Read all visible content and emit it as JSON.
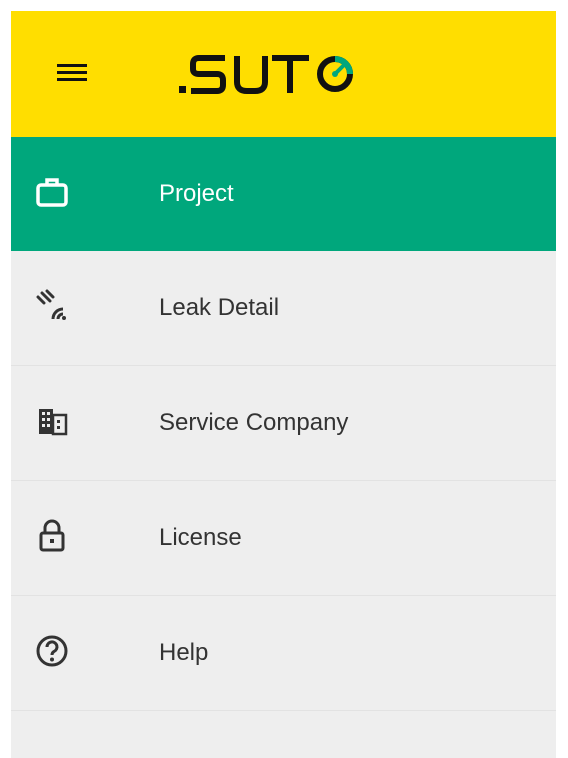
{
  "header": {
    "background_color": "#ffde00",
    "menu_icon": "hamburger-menu-icon",
    "logo": {
      "text": ".SUTO",
      "accent_color": "#00a77c"
    }
  },
  "menu": {
    "active_color": "#00a77c",
    "items": [
      {
        "label": "Project",
        "icon": "briefcase-icon",
        "active": true
      },
      {
        "label": "Leak Detail",
        "icon": "leak-signal-icon",
        "active": false
      },
      {
        "label": "Service Company",
        "icon": "building-icon",
        "active": false
      },
      {
        "label": "License",
        "icon": "lock-icon",
        "active": false
      },
      {
        "label": "Help",
        "icon": "help-circle-icon",
        "active": false
      }
    ]
  }
}
